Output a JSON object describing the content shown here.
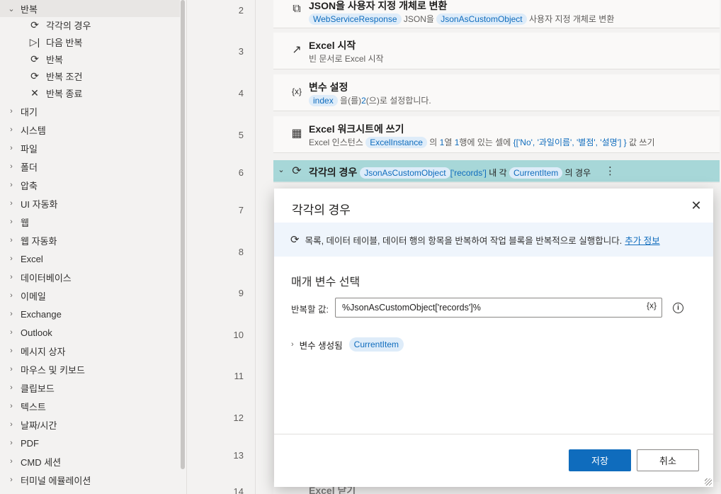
{
  "sidebar": {
    "loop_group": "반복",
    "loop_items": [
      "각각의 경우",
      "다음 반복",
      "반복",
      "반복 조건",
      "반복 종료"
    ],
    "groups": [
      "대기",
      "시스템",
      "파일",
      "폴더",
      "압축",
      "UI 자동화",
      "웹",
      "웹 자동화",
      "Excel",
      "데이터베이스",
      "이메일",
      "Exchange",
      "Outlook",
      "메시지 상자",
      "마우스 및 키보드",
      "클립보드",
      "텍스트",
      "날짜/시간",
      "PDF",
      "CMD 세션",
      "터미널 에뮬레이션"
    ]
  },
  "lines": [
    "2",
    "3",
    "4",
    "5",
    "6",
    "7",
    "8",
    "9",
    "10",
    "11",
    "12",
    "13",
    "14"
  ],
  "steps": {
    "s2": {
      "title": "JSON을 사용자 지정 개체로 변환",
      "chip1": "WebServiceResponse",
      "mid": "JSON을",
      "chip2": "JsonAsCustomObject",
      "tail": "사용자 지정 개체로 변환"
    },
    "s3": {
      "title": "Excel 시작",
      "desc": "빈 문서로 Excel 시작"
    },
    "s4": {
      "title": "변수 설정",
      "chip": "index",
      "mid": "을(를)",
      "val": "2",
      "tail": "(으)로 설정합니다."
    },
    "s5": {
      "title": "Excel 워크시트에 쓰기",
      "pre": "Excel 인스턴스",
      "chip": "ExcelInstance",
      "mid1": "의",
      "n1": "1",
      "mid2": "열",
      "n2": "1",
      "mid3": "행에 있는 셀에",
      "list": "{['No', '과일이름', '별점', '설명'] }",
      "tail": "값 쓰기"
    },
    "s6": {
      "title": "각각의 경우",
      "chip1": "JsonAsCustomObject",
      "key": "['records']",
      "mid": "내 각",
      "chip2": "CurrentItem",
      "tail": "의 경우"
    },
    "s14": {
      "title": "Excel 닫기"
    }
  },
  "dialog": {
    "title": "각각의 경우",
    "info_text": "목록, 데이터 테이블, 데이터 행의 항목을 반복하여 작업 블록을 반복적으로 실행합니다.",
    "info_link": "추가 정보",
    "section": "매개 변수 선택",
    "param_label": "반복할 값:",
    "param_value": "%JsonAsCustomObject['records']%",
    "var_button": "{x}",
    "vars_label": "변수 생성됨",
    "vars_chip": "CurrentItem",
    "save": "저장",
    "cancel": "취소"
  }
}
